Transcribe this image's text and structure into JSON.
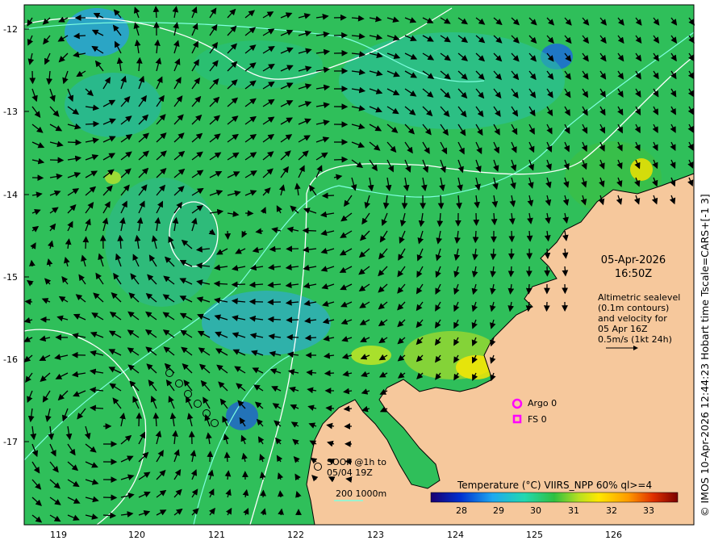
{
  "map": {
    "lat_ticks": [
      "-12",
      "-13",
      "-14",
      "-15",
      "-16",
      "-17"
    ],
    "lon_ticks": [
      "119",
      "120",
      "121",
      "122",
      "123",
      "124",
      "125",
      "126"
    ],
    "land_color": "#f6c89c",
    "sea_color": "#2fbf5a",
    "contour_color": "#ffffff",
    "shelf_color": "#7fffe0"
  },
  "timestamp": {
    "date": "05-Apr-2026",
    "time": "16:50Z"
  },
  "altimetry_note": {
    "lines": [
      "Altimetric sealevel",
      "(0.1m contours)",
      "and velocity for",
      "05 Apr 16Z",
      "0.5m/s (1kt 24h)"
    ]
  },
  "legend": {
    "argo": "Argo 0",
    "fs": "FS 0",
    "argo_color": "#ff00ff",
    "soop_lines": [
      "SOOP @1h to",
      "05/04 19Z"
    ],
    "isobath": "200  1000m"
  },
  "colorbar": {
    "title": "Temperature (°C) VIIRS_NPP 60% ql>=4",
    "ticks": [
      "28",
      "29",
      "30",
      "31",
      "32",
      "33"
    ]
  },
  "credit": "© IMOS 10-Apr-2026 12:44:23 Hobart time Tscale=CARS+[-1 3]"
}
